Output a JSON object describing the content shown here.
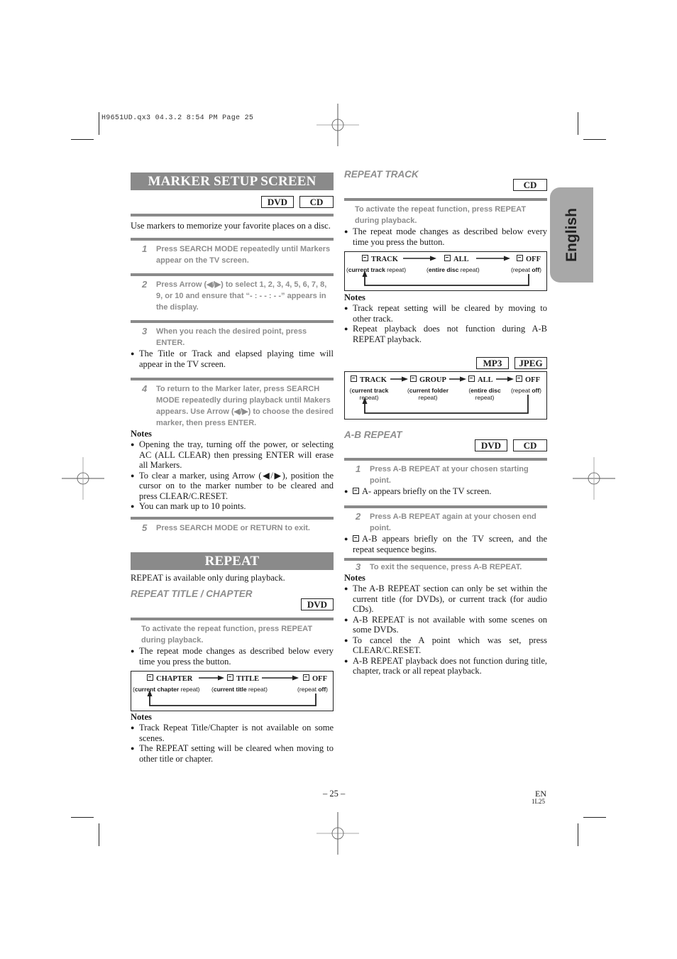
{
  "print_header": "H9651UD.qx3  04.3.2  8:54 PM  Page 25",
  "side_tab": "English",
  "left": {
    "marker": {
      "title": "MARKER SETUP SCREEN",
      "badges": [
        "DVD",
        "CD"
      ],
      "intro": "Use markers to memorize your favorite places on a disc.",
      "steps": [
        {
          "num": "1",
          "text": "Press SEARCH MODE repeatedly until Markers appear on the TV screen."
        },
        {
          "num": "2",
          "text": "Press Arrow (◀/▶) to select 1, 2, 3, 4, 5, 6, 7, 8, 9, or 10 and ensure that “- : - - : - -” appears in the display."
        },
        {
          "num": "3",
          "text": "When you reach the desired point, press ENTER."
        },
        {
          "num": "4",
          "text": "To return to the Marker later, press SEARCH MODE repeatedly during playback until Makers appears. Use Arrow (◀/▶) to choose the desired marker, then press ENTER."
        },
        {
          "num": "5",
          "text": "Press SEARCH MODE or RETURN to exit."
        }
      ],
      "step3_bullet": "The Title or Track and elapsed playing time will appear in the TV screen.",
      "notes_label": "Notes",
      "notes": [
        "Opening the tray, turning off the power, or selecting AC (ALL CLEAR) then pressing ENTER will erase all Markers.",
        "To clear a marker, using Arrow (◀/▶), position the cursor on to the marker number to be cleared and press CLEAR/C.RESET.",
        "You can mark up to 10 points."
      ]
    },
    "repeat": {
      "title": "REPEAT",
      "intro": "REPEAT is available only during playback.",
      "subtitle": "REPEAT TITLE / CHAPTER",
      "badges": [
        "DVD"
      ],
      "instruction": "To activate the repeat function, press REPEAT during playback.",
      "bullet": "The repeat mode changes as described below every time you press the button.",
      "diagram": {
        "items": [
          {
            "label": "CHAPTER",
            "bold": "current chapter",
            "rest": " repeat"
          },
          {
            "label": "TITLE",
            "bold": "current title",
            "rest": " repeat"
          },
          {
            "label": "OFF",
            "pre": "repeat ",
            "bold": "off"
          }
        ]
      },
      "notes_label": "Notes",
      "notes": [
        "Track Repeat Title/Chapter is not available on some scenes.",
        "The REPEAT setting will be cleared when moving to other title or chapter."
      ]
    }
  },
  "right": {
    "repeat_track": {
      "subtitle": "REPEAT TRACK",
      "badges": [
        "CD"
      ],
      "instruction": "To activate the repeat function, press REPEAT during playback.",
      "bullet": "The repeat mode changes as described below every time you press the button.",
      "diagram": {
        "items": [
          {
            "label": "TRACK",
            "bold": "current track",
            "rest": " repeat"
          },
          {
            "label": "ALL",
            "bold": "entire disc",
            "rest": " repeat"
          },
          {
            "label": "OFF",
            "pre": "repeat ",
            "bold": "off"
          }
        ]
      },
      "notes_label": "Notes",
      "notes": [
        "Track repeat setting will be cleared by moving to other track.",
        "Repeat playback does not function during A-B REPEAT playback."
      ]
    },
    "mp3": {
      "badges": [
        "MP3",
        "JPEG"
      ],
      "diagram": {
        "items": [
          {
            "label": "TRACK",
            "bold": "current track",
            "rest": "repeat)"
          },
          {
            "label": "GROUP",
            "bold": "current folder",
            "rest": "repeat)"
          },
          {
            "label": "ALL",
            "bold": "entire disc",
            "rest": "repeat)"
          },
          {
            "label": "OFF",
            "pre": "repeat ",
            "bold": "off"
          }
        ]
      }
    },
    "ab": {
      "subtitle": "A-B REPEAT",
      "badges": [
        "DVD",
        "CD"
      ],
      "steps": [
        {
          "num": "1",
          "text": "Press A-B REPEAT at your chosen starting point."
        },
        {
          "num": "2",
          "text": "Press A-B REPEAT again at your chosen end point."
        },
        {
          "num": "3",
          "text": "To exit the sequence, press A-B REPEAT."
        }
      ],
      "bullets": [
        "A- appears briefly on the TV screen.",
        "A-B appears briefly on the TV screen, and the repeat sequence begins."
      ],
      "notes_label": "Notes",
      "notes": [
        "The A-B REPEAT section can only be set within the current title (for DVDs), or current track (for audio CDs).",
        "A-B REPEAT is not available with some scenes on some DVDs.",
        "To cancel the A point which was set, press CLEAR/C.RESET.",
        "A-B REPEAT playback does not function during title, chapter, track or all repeat playback."
      ]
    }
  },
  "footer": {
    "page": "– 25 –",
    "lang": "EN",
    "code": "1L25"
  }
}
